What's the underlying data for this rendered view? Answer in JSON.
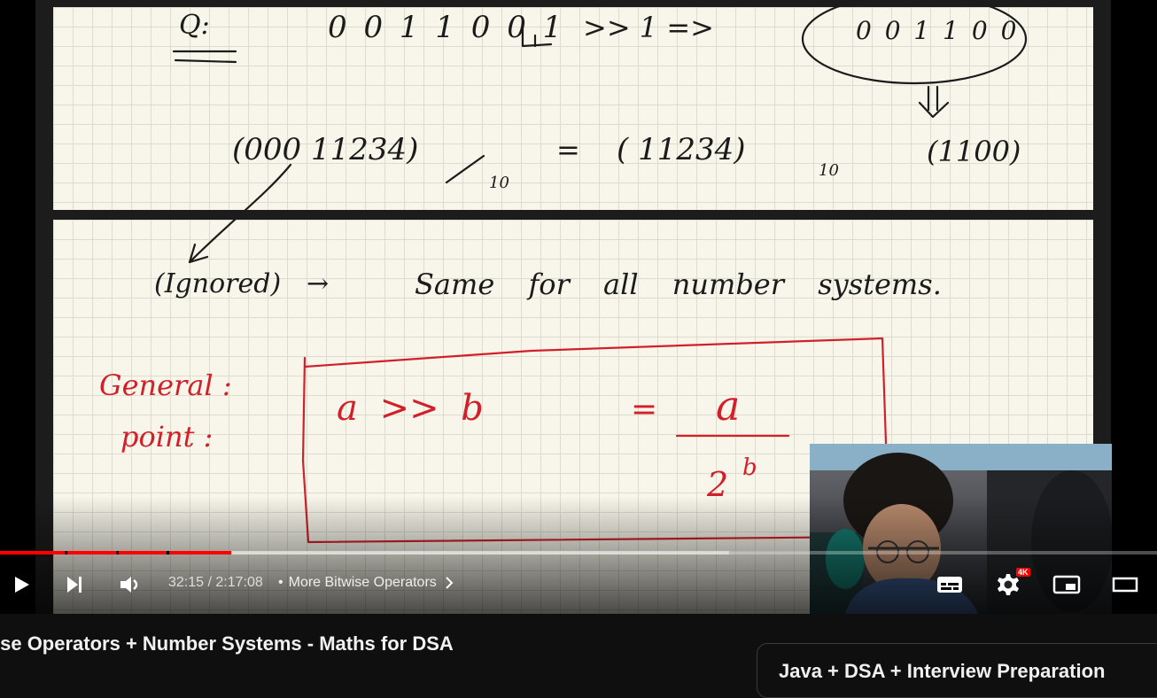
{
  "player": {
    "current_time": "32:15",
    "duration": "2:17:08",
    "separator": " / ",
    "chapter_bullet": "•",
    "chapter_title": "More Bitwise Operators",
    "quality_badge": "4K",
    "progress_played_fraction": 0.2,
    "progress_buffered_fraction": 0.63,
    "accent_color": "#ff0000"
  },
  "controls": {
    "play_icon": "play-icon",
    "next_icon": "next-icon",
    "volume_icon": "volume-icon",
    "subtitles_icon": "subtitles-icon",
    "settings_icon": "settings-icon",
    "miniplayer_icon": "miniplayer-icon",
    "theater_icon": "theater-icon"
  },
  "whiteboard": {
    "q_label": "Q:",
    "binary_left": "0 0 1 1 0 0 1",
    "shift_op": ">> 1 =>",
    "binary_result": "0 0 1 1 0 0",
    "expr_left": "(000 11234)",
    "expr_left_base": "10",
    "equals": "=",
    "expr_right": "( 11234)",
    "expr_right_base": "10",
    "expr_result": "(1100)",
    "ignored": "(Ignored)",
    "arrow": "→",
    "same_note": "Same for all number systems.",
    "general_point_1": "General :",
    "general_point_2": "point :",
    "formula_lhs": "a  >>  b",
    "formula_eq": "=",
    "formula_num": "a",
    "formula_den_base": "2",
    "formula_den_exp": "b"
  },
  "below": {
    "video_title": "ise Operators + Number Systems - Maths for DSA",
    "side_card_title": "Java + DSA + Interview Preparation"
  }
}
